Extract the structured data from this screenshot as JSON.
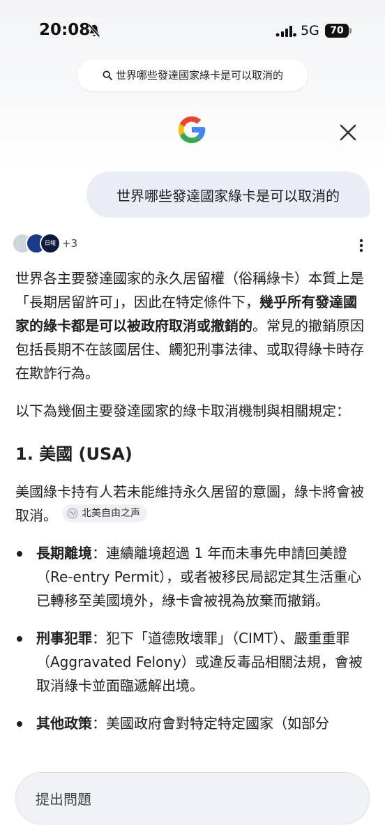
{
  "status_bar": {
    "time": "20:08",
    "network": "5G",
    "battery": "70"
  },
  "search_pill": {
    "query": "世界哪些發達國家綠卡是可以取消的"
  },
  "user_query": "世界哪些發達國家綠卡是可以取消的",
  "sources": {
    "more_count": "+3",
    "avatar_3_text": "日報"
  },
  "answer": {
    "intro_part1": "世界各主要發達國家的永久居留權（俗稱綠卡）本質上是「長期居留許可」，因此在特定條件下，",
    "intro_bold": "幾乎所有發達國家的綠卡都是可以被政府取消或撤銷的",
    "intro_part2": "。常見的撤銷原因包括長期不在該國居住、觸犯刑事法律、或取得綠卡時存在欺詐行為。",
    "lead": "以下為幾個主要發達國家的綠卡取消機制與相關規定：",
    "section_title": "1. 美國 (USA)",
    "section_intro": "美國綠卡持有人若未能維持永久居留的意圖，綠卡將會被取消。",
    "source_chip": "北美自由之声",
    "bullets": [
      {
        "term": "長期離境",
        "text": "：連續離境超過 1 年而未事先申請回美證（Re-entry Permit），或者被移民局認定其生活重心已轉移至美國境外，綠卡會被視為放棄而撤銷。"
      },
      {
        "term": "刑事犯罪",
        "text": "：犯下「道德敗壞罪」（CIMT）、嚴重重罪（Aggravated Felony）或違反毒品相關法規，會被取消綠卡並面臨遞解出境。"
      },
      {
        "term": "其他政策",
        "text": "：美國政府會對特定特定國家（如部分"
      }
    ]
  },
  "ask_input": {
    "placeholder": "提出問題"
  },
  "colors": {
    "query_bubble": "#e9eef6",
    "google_blue": "#4285F4",
    "google_red": "#EA4335",
    "google_yellow": "#FBBC05",
    "google_green": "#34A853"
  }
}
